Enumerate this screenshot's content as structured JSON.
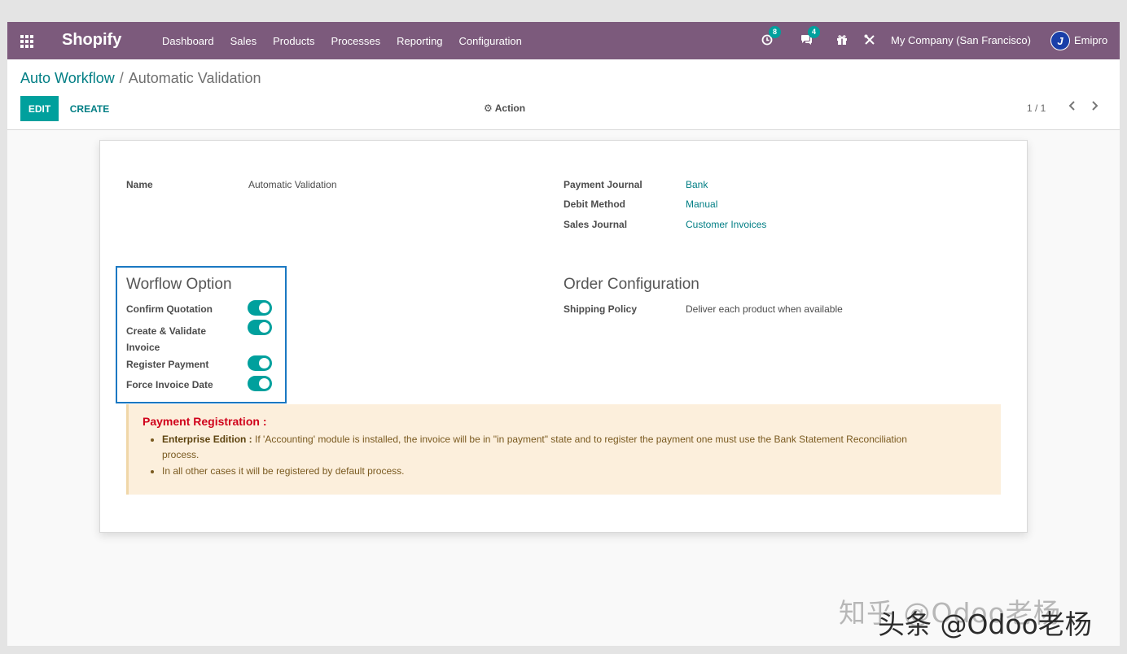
{
  "navbar": {
    "brand": "Shopify",
    "menu": [
      "Dashboard",
      "Sales",
      "Products",
      "Processes",
      "Reporting",
      "Configuration"
    ],
    "activity_count": "8",
    "message_count": "4",
    "company": "My Company (San Francisco)",
    "user": "Emipro",
    "avatar_letter": "J",
    "icons": [
      "apps-grid-icon",
      "activity-clock-icon",
      "chat-icon",
      "gift-icon",
      "tools-icon"
    ]
  },
  "control": {
    "breadcrumb_parent": "Auto Workflow",
    "breadcrumb_sep": "/",
    "breadcrumb_current": "Automatic Validation",
    "edit_label": "EDIT",
    "create_label": "CREATE",
    "action_label": "Action",
    "pager": "1 / 1",
    "prev_glyph": "‹",
    "next_glyph": "›"
  },
  "form": {
    "name_label": "Name",
    "name_value": "Automatic Validation",
    "payment_journal_label": "Payment Journal",
    "payment_journal_value": "Bank",
    "debit_method_label": "Debit Method",
    "debit_method_value": "Manual",
    "sales_journal_label": "Sales Journal",
    "sales_journal_value": "Customer Invoices",
    "workflow_title": "Worflow Option",
    "options": [
      {
        "label": "Confirm Quotation",
        "enabled": true
      },
      {
        "label": "Create & Validate Invoice",
        "enabled": true
      },
      {
        "label": "Register Payment",
        "enabled": true
      },
      {
        "label": "Force Invoice Date",
        "enabled": true
      }
    ],
    "order_title": "Order Configuration",
    "shipping_policy_label": "Shipping Policy",
    "shipping_policy_value": "Deliver each product when available"
  },
  "alert": {
    "title": "Payment Registration :",
    "item1_bold": "Enterprise Edition :",
    "item1_text": " If 'Accounting' module is installed, the invoice will be in \"in payment\" state and to register the payment one must use the Bank Statement Reconciliation process.",
    "item2_text": "In all other cases it will be registered by default process."
  },
  "watermark": {
    "line1": "知乎 @Odoo老杨",
    "line2": "头条 @Odoo老杨"
  }
}
